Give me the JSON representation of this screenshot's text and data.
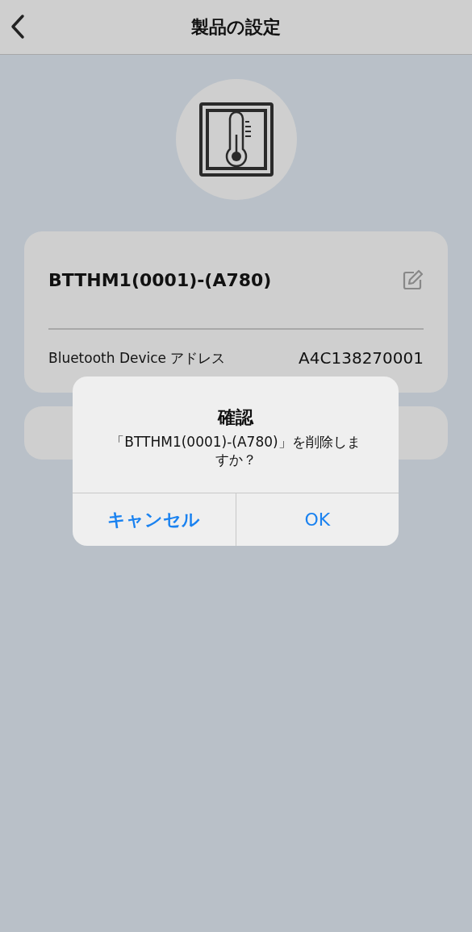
{
  "header": {
    "title": "製品の設定"
  },
  "device": {
    "name": "BTTHM1(0001)-(A780)",
    "address_label": "Bluetooth Device アドレス",
    "address": "A4C138270001"
  },
  "dialog": {
    "title": "確認",
    "message": "「BTTHM1(0001)-(A780)」を削除しますか？",
    "buttons": [
      {
        "label": "キャンセル",
        "kind": "cancel"
      },
      {
        "label": "OK",
        "kind": "default"
      }
    ]
  }
}
